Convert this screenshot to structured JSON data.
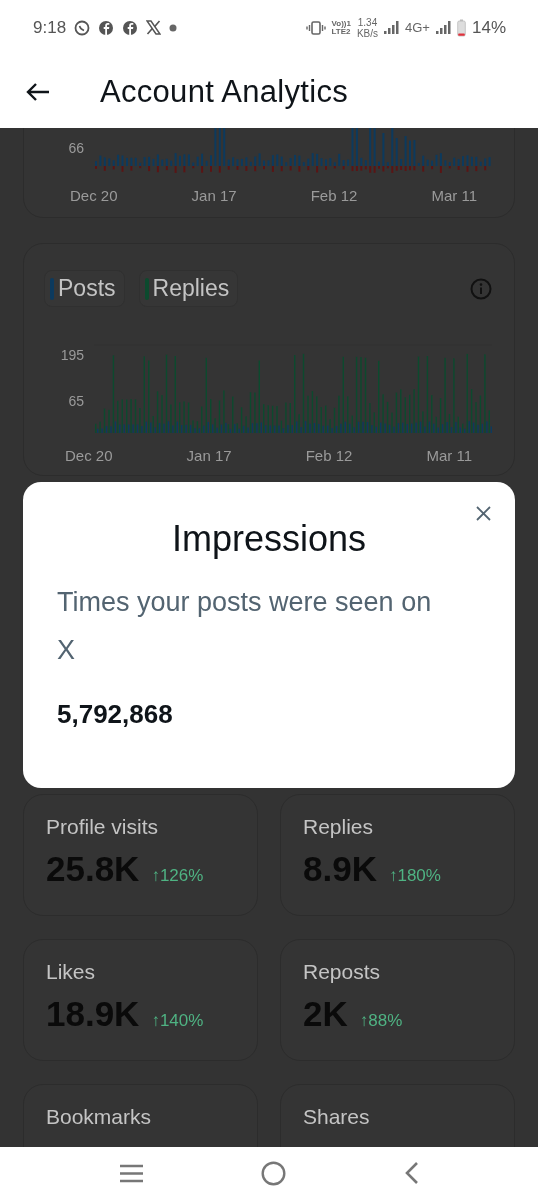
{
  "status_bar": {
    "time": "9:18",
    "volte_top": "Vo))1",
    "volte_bottom": "LTE2",
    "speed": "1.34",
    "speed_unit": "KB/s",
    "network_type": "4G+",
    "battery": "14%"
  },
  "header": {
    "title": "Account Analytics"
  },
  "charts": [
    {
      "kind": "signed",
      "y_labels": [
        "66"
      ],
      "x_labels": [
        "Dec 20",
        "Jan 17",
        "Feb 12",
        "Mar 11"
      ],
      "series": [
        {
          "color": "#0c3a5e"
        },
        {
          "color": "#5a1414"
        }
      ]
    },
    {
      "kind": "legend",
      "legend": [
        {
          "label": "Posts",
          "color": "#0c3a5e"
        },
        {
          "label": "Replies",
          "color": "#0c4a2e"
        }
      ],
      "y_labels": [
        "195",
        "65"
      ],
      "x_labels": [
        "Dec 20",
        "Jan 17",
        "Feb 12",
        "Mar 11"
      ]
    }
  ],
  "modal": {
    "title": "Impressions",
    "description": "Times your posts were seen on X",
    "value": "5,792,868"
  },
  "stats": [
    {
      "label": "Profile visits",
      "value": "25.8K",
      "change": "↑126%"
    },
    {
      "label": "Replies",
      "value": "8.9K",
      "change": "↑180%"
    },
    {
      "label": "Likes",
      "value": "18.9K",
      "change": "↑140%"
    },
    {
      "label": "Reposts",
      "value": "2K",
      "change": "↑88%"
    },
    {
      "label": "Bookmarks"
    },
    {
      "label": "Shares"
    }
  ]
}
